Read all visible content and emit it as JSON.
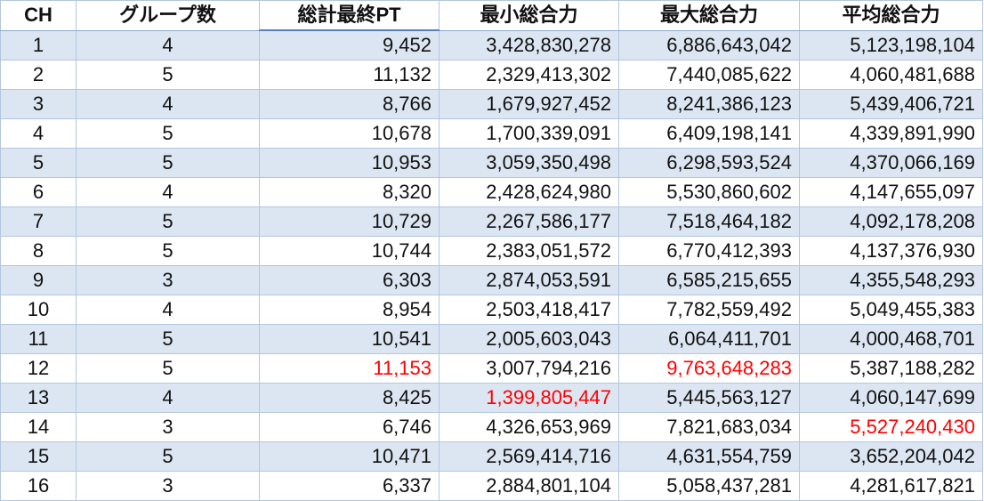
{
  "colors": {
    "band": "#dce6f2",
    "highlight": "#ff0000",
    "border": "#b4c6de"
  },
  "headers": [
    "CH",
    "グループ数",
    "総計最終PT",
    "最小総合力",
    "最大総合力",
    "平均総合力"
  ],
  "rows": [
    {
      "ch": "1",
      "groups": "4",
      "total_pt": "9,452",
      "min": "3,428,830,278",
      "max": "6,886,643,042",
      "avg": "5,123,198,104"
    },
    {
      "ch": "2",
      "groups": "5",
      "total_pt": "11,132",
      "min": "2,329,413,302",
      "max": "7,440,085,622",
      "avg": "4,060,481,688"
    },
    {
      "ch": "3",
      "groups": "4",
      "total_pt": "8,766",
      "min": "1,679,927,452",
      "max": "8,241,386,123",
      "avg": "5,439,406,721"
    },
    {
      "ch": "4",
      "groups": "5",
      "total_pt": "10,678",
      "min": "1,700,339,091",
      "max": "6,409,198,141",
      "avg": "4,339,891,990"
    },
    {
      "ch": "5",
      "groups": "5",
      "total_pt": "10,953",
      "min": "3,059,350,498",
      "max": "6,298,593,524",
      "avg": "4,370,066,169"
    },
    {
      "ch": "6",
      "groups": "4",
      "total_pt": "8,320",
      "min": "2,428,624,980",
      "max": "5,530,860,602",
      "avg": "4,147,655,097"
    },
    {
      "ch": "7",
      "groups": "5",
      "total_pt": "10,729",
      "min": "2,267,586,177",
      "max": "7,518,464,182",
      "avg": "4,092,178,208"
    },
    {
      "ch": "8",
      "groups": "5",
      "total_pt": "10,744",
      "min": "2,383,051,572",
      "max": "6,770,412,393",
      "avg": "4,137,376,930"
    },
    {
      "ch": "9",
      "groups": "3",
      "total_pt": "6,303",
      "min": "2,874,053,591",
      "max": "6,585,215,655",
      "avg": "4,355,548,293"
    },
    {
      "ch": "10",
      "groups": "4",
      "total_pt": "8,954",
      "min": "2,503,418,417",
      "max": "7,782,559,492",
      "avg": "5,049,455,383"
    },
    {
      "ch": "11",
      "groups": "5",
      "total_pt": "10,541",
      "min": "2,005,603,043",
      "max": "6,064,411,701",
      "avg": "4,000,468,701"
    },
    {
      "ch": "12",
      "groups": "5",
      "total_pt": "11,153",
      "min": "3,007,794,216",
      "max": "9,763,648,283",
      "avg": "5,387,188,282",
      "highlight": [
        "total_pt",
        "max"
      ]
    },
    {
      "ch": "13",
      "groups": "4",
      "total_pt": "8,425",
      "min": "1,399,805,447",
      "max": "5,445,563,127",
      "avg": "4,060,147,699",
      "highlight": [
        "min"
      ]
    },
    {
      "ch": "14",
      "groups": "3",
      "total_pt": "6,746",
      "min": "4,326,653,969",
      "max": "7,821,683,034",
      "avg": "5,527,240,430",
      "highlight": [
        "avg"
      ]
    },
    {
      "ch": "15",
      "groups": "5",
      "total_pt": "10,471",
      "min": "2,569,414,716",
      "max": "4,631,554,759",
      "avg": "3,652,204,042"
    },
    {
      "ch": "16",
      "groups": "3",
      "total_pt": "6,337",
      "min": "2,884,801,104",
      "max": "5,058,437,281",
      "avg": "4,281,617,821"
    }
  ]
}
